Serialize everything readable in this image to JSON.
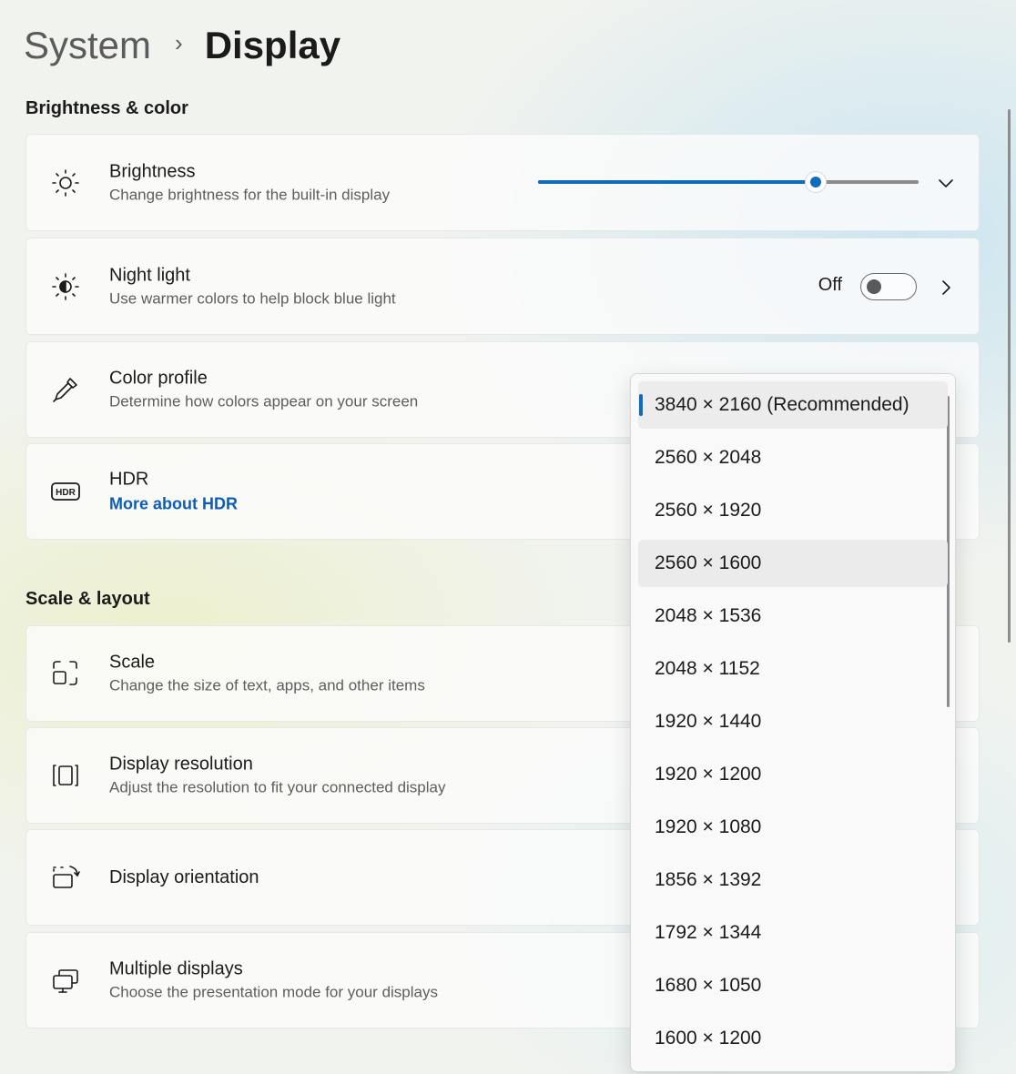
{
  "breadcrumb": {
    "parent": "System",
    "separator": "›",
    "current": "Display"
  },
  "sections": {
    "brightness_color": "Brightness & color",
    "scale_layout": "Scale & layout"
  },
  "brightness": {
    "title": "Brightness",
    "subtitle": "Change brightness for the built-in display",
    "value_fraction": 0.73,
    "icon": "brightness-sun-icon"
  },
  "night_light": {
    "title": "Night light",
    "subtitle": "Use warmer colors to help block blue light",
    "toggle_label": "Off",
    "toggle_on": false,
    "icon": "night-light-icon"
  },
  "color_profile": {
    "title": "Color profile",
    "subtitle": "Determine how colors appear on your screen",
    "icon": "eyedropper-icon"
  },
  "hdr": {
    "title": "HDR",
    "link": "More about HDR",
    "icon": "hdr-icon"
  },
  "scale": {
    "title": "Scale",
    "subtitle": "Change the size of text, apps, and other items",
    "icon": "scale-icon"
  },
  "display_resolution": {
    "title": "Display resolution",
    "subtitle": "Adjust the resolution to fit your connected display",
    "icon": "resolution-icon"
  },
  "display_orientation": {
    "title": "Display orientation",
    "icon": "orientation-icon"
  },
  "multiple_displays": {
    "title": "Multiple displays",
    "subtitle": "Choose the presentation mode for your displays",
    "icon": "multiple-displays-icon"
  },
  "resolution_dropdown": {
    "options": [
      "3840 × 2160 (Recommended)",
      "2560 × 2048",
      "2560 × 1920",
      "2560 × 1600",
      "2048 × 1536",
      "2048 × 1152",
      "1920 × 1440",
      "1920 × 1200",
      "1920 × 1080",
      "1856 × 1392",
      "1792 × 1344",
      "1680 × 1050",
      "1600 × 1200"
    ],
    "selected_index": 0,
    "hover_index": 3
  },
  "colors": {
    "accent": "#0f6cbd",
    "link": "#0f5db8"
  }
}
